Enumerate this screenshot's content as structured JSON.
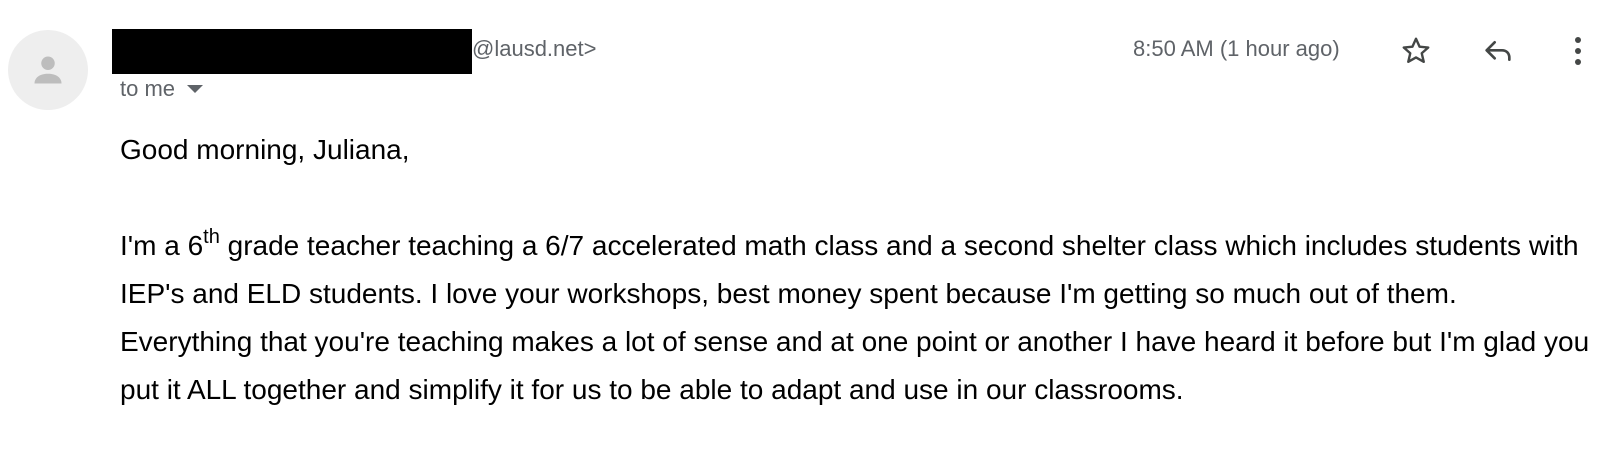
{
  "email": {
    "sender": {
      "domain_suffix": "@lausd.net>"
    },
    "recipient_label": "to me",
    "timestamp": "8:50 AM (1 hour ago)",
    "actions": {
      "star_icon": "star-outline-icon",
      "reply_icon": "reply-icon",
      "more_icon": "more-vertical-icon"
    },
    "body": {
      "greeting": "Good morning, Juliana,",
      "para_prefix": "I'm a 6",
      "para_sup": "th",
      "para_rest": " grade teacher teaching a 6/7 accelerated math class and a second shelter class which includes students with IEP's and ELD students. I love your workshops, best money spent because I'm getting so much out of them.  Everything that you're teaching makes a lot of sense and at one point or another I have heard it before but I'm glad you put it ALL together and simplify it for us to be able to adapt and use in our classrooms."
    }
  },
  "colors": {
    "meta_text": "#5f6368",
    "body_text": "#000000",
    "avatar_bg": "#eeeeee",
    "avatar_fg": "#bdbdbd"
  }
}
